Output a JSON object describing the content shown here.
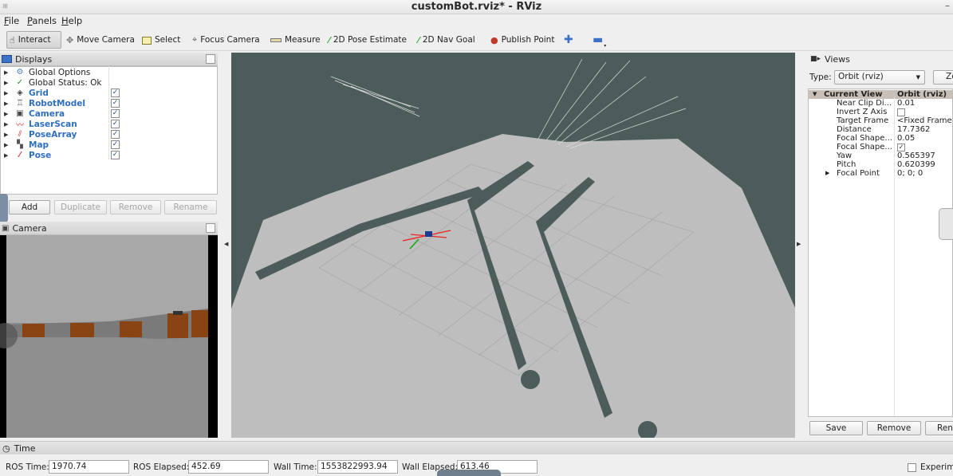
{
  "window": {
    "title": "customBot.rviz* - RViz",
    "minimize_glyph": "–"
  },
  "menu": [
    "File",
    "Panels",
    "Help"
  ],
  "toolbar": {
    "interact": "Interact",
    "move_camera": "Move Camera",
    "select": "Select",
    "focus_camera": "Focus Camera",
    "measure": "Measure",
    "pose_estimate": "2D Pose Estimate",
    "nav_goal": "2D Nav Goal",
    "publish_point": "Publish Point"
  },
  "displays": {
    "title": "Displays",
    "items": [
      {
        "label": "Global Options",
        "icon": "gear-icon",
        "enabled": null,
        "bold": false
      },
      {
        "label": "Global Status: Ok",
        "icon": "check-icon",
        "enabled": null,
        "bold": false
      },
      {
        "label": "Grid",
        "icon": "grid-icon",
        "enabled": true,
        "bold": true
      },
      {
        "label": "RobotModel",
        "icon": "robot-icon",
        "enabled": true,
        "bold": true
      },
      {
        "label": "Camera",
        "icon": "camera-icon",
        "enabled": true,
        "bold": true
      },
      {
        "label": "LaserScan",
        "icon": "laser-icon",
        "enabled": true,
        "bold": true
      },
      {
        "label": "PoseArray",
        "icon": "pose-array-icon",
        "enabled": true,
        "bold": true
      },
      {
        "label": "Map",
        "icon": "map-icon",
        "enabled": true,
        "bold": true
      },
      {
        "label": "Pose",
        "icon": "pose-icon",
        "enabled": true,
        "bold": true
      }
    ],
    "buttons": {
      "add": "Add",
      "duplicate": "Duplicate",
      "remove": "Remove",
      "rename": "Rename"
    }
  },
  "camera_panel": {
    "title": "Camera"
  },
  "views": {
    "title": "Views",
    "type_label": "Type:",
    "type_value": "Orbit (rviz)",
    "zero_label": "Zero",
    "header": {
      "name": "Current View",
      "value": "Orbit (rviz)"
    },
    "properties": [
      {
        "name": "Near Clip Di...",
        "value": "0.01"
      },
      {
        "name": "Invert Z Axis",
        "value": ""
      },
      {
        "name": "Target Frame",
        "value": "<Fixed Frame>"
      },
      {
        "name": "Distance",
        "value": "17.7362"
      },
      {
        "name": "Focal Shape...",
        "value": "0.05"
      },
      {
        "name": "Focal Shape...",
        "value": "✓"
      },
      {
        "name": "Yaw",
        "value": "0.565397"
      },
      {
        "name": "Pitch",
        "value": "0.620399"
      },
      {
        "name": "Focal Point",
        "value": "0; 0; 0"
      }
    ],
    "buttons": {
      "save": "Save",
      "remove": "Remove",
      "rename": "Rename"
    }
  },
  "time": {
    "title": "Time",
    "ros_time_label": "ROS Time:",
    "ros_time": "1970.74",
    "ros_elapsed_label": "ROS Elapsed:",
    "ros_elapsed": "452.69",
    "wall_time_label": "Wall Time:",
    "wall_time": "1553822993.94",
    "wall_elapsed_label": "Wall Elapsed:",
    "wall_elapsed": "613.46",
    "experimental_label": "Experimental"
  }
}
